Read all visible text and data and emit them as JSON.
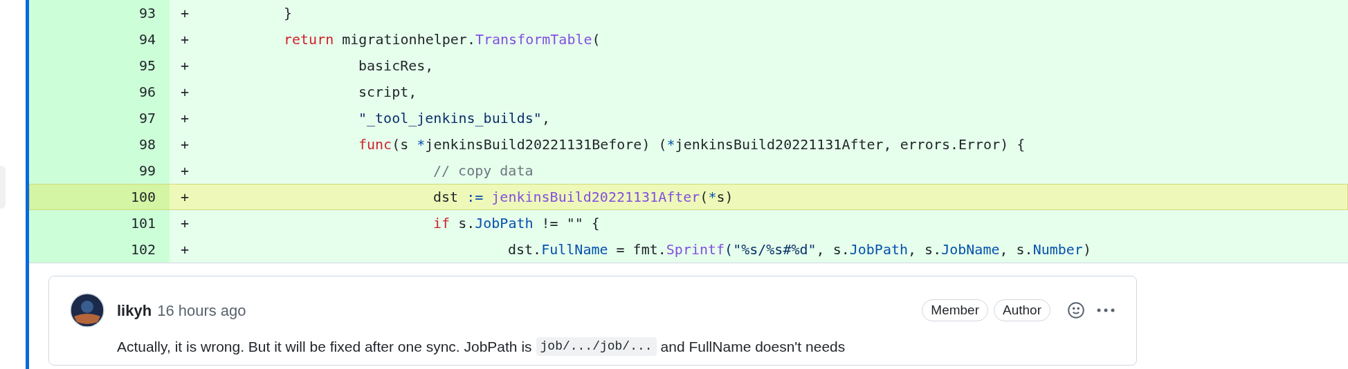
{
  "diff": {
    "lines": [
      {
        "number": "93",
        "marker": "+",
        "selected": false,
        "tokens": [
          {
            "text": "\t}",
            "kind": "plain"
          }
        ]
      },
      {
        "number": "94",
        "marker": "+",
        "selected": false,
        "tokens": [
          {
            "text": "\treturn",
            "kind": "keyword"
          },
          {
            "text": " migrationhelper.",
            "kind": "plain"
          },
          {
            "text": "TransformTable",
            "kind": "function"
          },
          {
            "text": "(",
            "kind": "plain"
          }
        ]
      },
      {
        "number": "95",
        "marker": "+",
        "selected": false,
        "tokens": [
          {
            "text": "\t\tbasicRes,",
            "kind": "plain"
          }
        ]
      },
      {
        "number": "96",
        "marker": "+",
        "selected": false,
        "tokens": [
          {
            "text": "\t\tscript,",
            "kind": "plain"
          }
        ]
      },
      {
        "number": "97",
        "marker": "+",
        "selected": false,
        "tokens": [
          {
            "text": "\t\t\"_tool_jenkins_builds\"",
            "kind": "string"
          },
          {
            "text": ",",
            "kind": "plain"
          }
        ]
      },
      {
        "number": "98",
        "marker": "+",
        "selected": false,
        "tokens": [
          {
            "text": "\t\tfunc",
            "kind": "keyword"
          },
          {
            "text": "(s ",
            "kind": "plain"
          },
          {
            "text": "*",
            "kind": "operator"
          },
          {
            "text": "jenkinsBuild20221131Before) (",
            "kind": "plain"
          },
          {
            "text": "*",
            "kind": "operator"
          },
          {
            "text": "jenkinsBuild20221131After, errors.Error) {",
            "kind": "plain"
          }
        ]
      },
      {
        "number": "99",
        "marker": "+",
        "selected": false,
        "tokens": [
          {
            "text": "\t\t\t// copy data",
            "kind": "comment"
          }
        ]
      },
      {
        "number": "100",
        "marker": "+",
        "selected": true,
        "tokens": [
          {
            "text": "\t\t\tdst ",
            "kind": "plain"
          },
          {
            "text": ":=",
            "kind": "operator"
          },
          {
            "text": " jenkinsBuild20221131After",
            "kind": "function"
          },
          {
            "text": "(",
            "kind": "plain"
          },
          {
            "text": "*",
            "kind": "operator"
          },
          {
            "text": "s)",
            "kind": "plain"
          }
        ]
      },
      {
        "number": "101",
        "marker": "+",
        "selected": false,
        "tokens": [
          {
            "text": "\t\t\tif",
            "kind": "keyword"
          },
          {
            "text": " s.",
            "kind": "plain"
          },
          {
            "text": "JobPath",
            "kind": "property"
          },
          {
            "text": " != \"\" {",
            "kind": "plain"
          }
        ]
      },
      {
        "number": "102",
        "marker": "+",
        "selected": false,
        "tokens": [
          {
            "text": "\t\t\t\tdst.",
            "kind": "plain"
          },
          {
            "text": "FullName",
            "kind": "property"
          },
          {
            "text": " = fmt.",
            "kind": "plain"
          },
          {
            "text": "Sprintf",
            "kind": "function"
          },
          {
            "text": "(\"%s/%s#%d\"",
            "kind": "string"
          },
          {
            "text": ", s.",
            "kind": "plain"
          },
          {
            "text": "JobPath",
            "kind": "property"
          },
          {
            "text": ", s.",
            "kind": "plain"
          },
          {
            "text": "JobName",
            "kind": "property"
          },
          {
            "text": ", s.",
            "kind": "plain"
          },
          {
            "text": "Number",
            "kind": "property"
          },
          {
            "text": ")",
            "kind": "plain"
          }
        ]
      }
    ]
  },
  "comment": {
    "author": "likyh",
    "time": "16 hours ago",
    "badges": [
      "Member",
      "Author"
    ],
    "body": [
      {
        "text": "Actually, it is wrong. But it will be fixed after one sync. JobPath is",
        "kind": "text"
      },
      {
        "text": "job/.../job/...",
        "kind": "code"
      },
      {
        "text": "and FullName doesn't needs",
        "kind": "text"
      }
    ]
  }
}
